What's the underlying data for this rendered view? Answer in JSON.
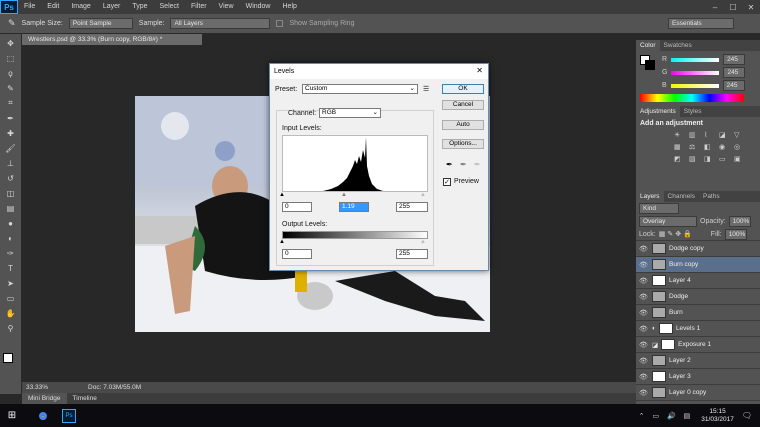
{
  "app": {
    "logo": "Ps"
  },
  "menu": [
    "File",
    "Edit",
    "Image",
    "Layer",
    "Type",
    "Select",
    "Filter",
    "View",
    "Window",
    "Help"
  ],
  "window_controls": {
    "minimize": "–",
    "maximize": "☐",
    "close": "✕"
  },
  "options_bar": {
    "tool_icon": "eyedropper-icon",
    "sample_size_label": "Sample Size:",
    "sample_size_value": "Point Sample",
    "sample_label": "Sample:",
    "sample_value": "All Layers",
    "show_ring_label": "Show Sampling Ring",
    "workspace": "Essentials"
  },
  "document": {
    "tab_title": "Wrestlers.psd @ 33.3% (Burn copy, RGB/8#) *",
    "zoom": "33.33%",
    "doc_info": "Doc: 7.03M/55.0M"
  },
  "bottom_tabs": [
    "Mini Bridge",
    "Timeline"
  ],
  "levels_dialog": {
    "title": "Levels",
    "preset_label": "Preset:",
    "preset_value": "Custom",
    "channel_label": "Channel:",
    "channel_value": "RGB",
    "input_levels_label": "Input Levels:",
    "input_black": "0",
    "input_gamma": "1.19",
    "input_white": "255",
    "output_levels_label": "Output Levels:",
    "output_black": "0",
    "output_white": "255",
    "buttons": {
      "ok": "OK",
      "cancel": "Cancel",
      "auto": "Auto",
      "options": "Options..."
    },
    "preview_label": "Preview",
    "preview_checked": true
  },
  "color_panel": {
    "tabs": [
      "Color",
      "Swatches"
    ],
    "channels": [
      {
        "label": "R",
        "value": "245"
      },
      {
        "label": "G",
        "value": "245"
      },
      {
        "label": "B",
        "value": "245"
      }
    ]
  },
  "adjustments_panel": {
    "tabs": [
      "Adjustments",
      "Styles"
    ],
    "heading": "Add an adjustment"
  },
  "layers_panel": {
    "tabs": [
      "Layers",
      "Channels",
      "Paths"
    ],
    "kind_label": "Kind",
    "blend_mode": "Overlay",
    "opacity_label": "Opacity:",
    "opacity_value": "100%",
    "lock_label": "Lock:",
    "fill_label": "Fill:",
    "fill_value": "100%",
    "layers": [
      {
        "name": "Dodge copy",
        "selected": false
      },
      {
        "name": "Burn copy",
        "selected": true
      },
      {
        "name": "Layer 4",
        "selected": false
      },
      {
        "name": "Dodge",
        "selected": false
      },
      {
        "name": "Burn",
        "selected": false
      },
      {
        "name": "Levels 1",
        "selected": false
      },
      {
        "name": "Exposure 1",
        "selected": false
      },
      {
        "name": "Layer 2",
        "selected": false
      },
      {
        "name": "Layer 3",
        "selected": false
      },
      {
        "name": "Layer 0 copy",
        "selected": false
      }
    ]
  },
  "taskbar": {
    "time": "15:15",
    "date": "31/03/2017"
  }
}
